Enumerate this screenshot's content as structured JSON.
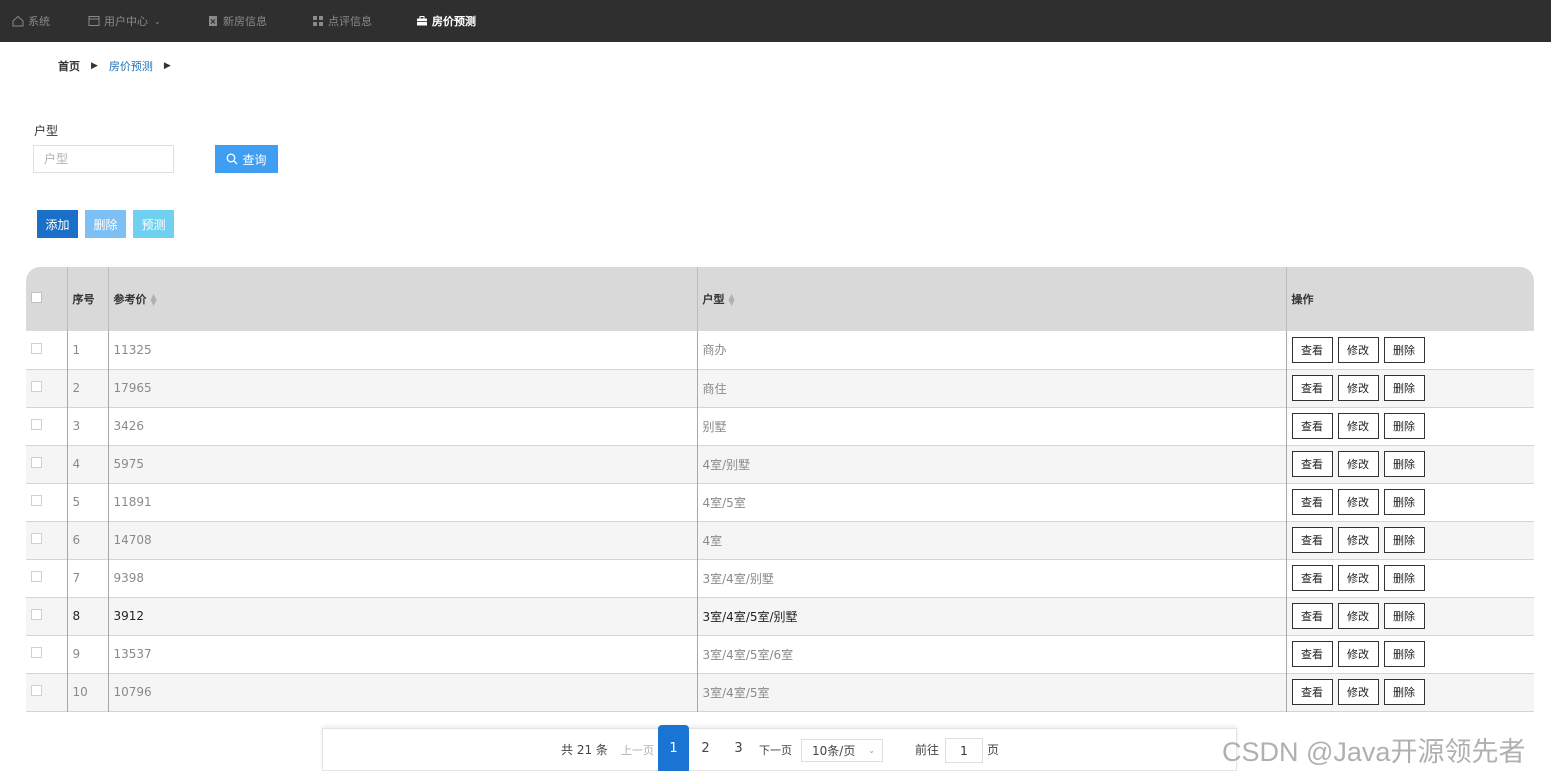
{
  "nav": {
    "items": [
      {
        "label": "系统",
        "icon": "home-icon"
      },
      {
        "label": "用户中心",
        "icon": "window-icon"
      },
      {
        "label": "新房信息",
        "icon": "doc-x-icon"
      },
      {
        "label": "点评信息",
        "icon": "grid-icon"
      },
      {
        "label": "房价预测",
        "icon": "briefcase-icon"
      }
    ]
  },
  "breadcrumb": {
    "home": "首页",
    "current": "房价预测"
  },
  "search": {
    "label": "户型",
    "placeholder": "户型",
    "button": "查询"
  },
  "actions": {
    "add": "添加",
    "delete": "删除",
    "predict": "预测"
  },
  "table": {
    "headers": {
      "index": "序号",
      "price": "参考价",
      "type": "户型",
      "ops": "操作"
    },
    "op_labels": {
      "view": "查看",
      "edit": "修改",
      "delete": "删除"
    },
    "rows": [
      {
        "index": "1",
        "price": "11325",
        "type": "商办"
      },
      {
        "index": "2",
        "price": "17965",
        "type": "商住"
      },
      {
        "index": "3",
        "price": "3426",
        "type": "别墅"
      },
      {
        "index": "4",
        "price": "5975",
        "type": "4室/别墅"
      },
      {
        "index": "5",
        "price": "11891",
        "type": "4室/5室"
      },
      {
        "index": "6",
        "price": "14708",
        "type": "4室"
      },
      {
        "index": "7",
        "price": "9398",
        "type": "3室/4室/别墅"
      },
      {
        "index": "8",
        "price": "3912",
        "type": "3室/4室/5室/别墅"
      },
      {
        "index": "9",
        "price": "13537",
        "type": "3室/4室/5室/6室"
      },
      {
        "index": "10",
        "price": "10796",
        "type": "3室/4室/5室"
      }
    ]
  },
  "pagination": {
    "total": "共 21 条",
    "prev": "上一页",
    "pages": [
      "1",
      "2",
      "3"
    ],
    "next": "下一页",
    "page_size": "10条/页",
    "goto_label": "前往",
    "goto_value": "1",
    "page_suffix": "页"
  },
  "watermark": "CSDN @Java开源领先者"
}
